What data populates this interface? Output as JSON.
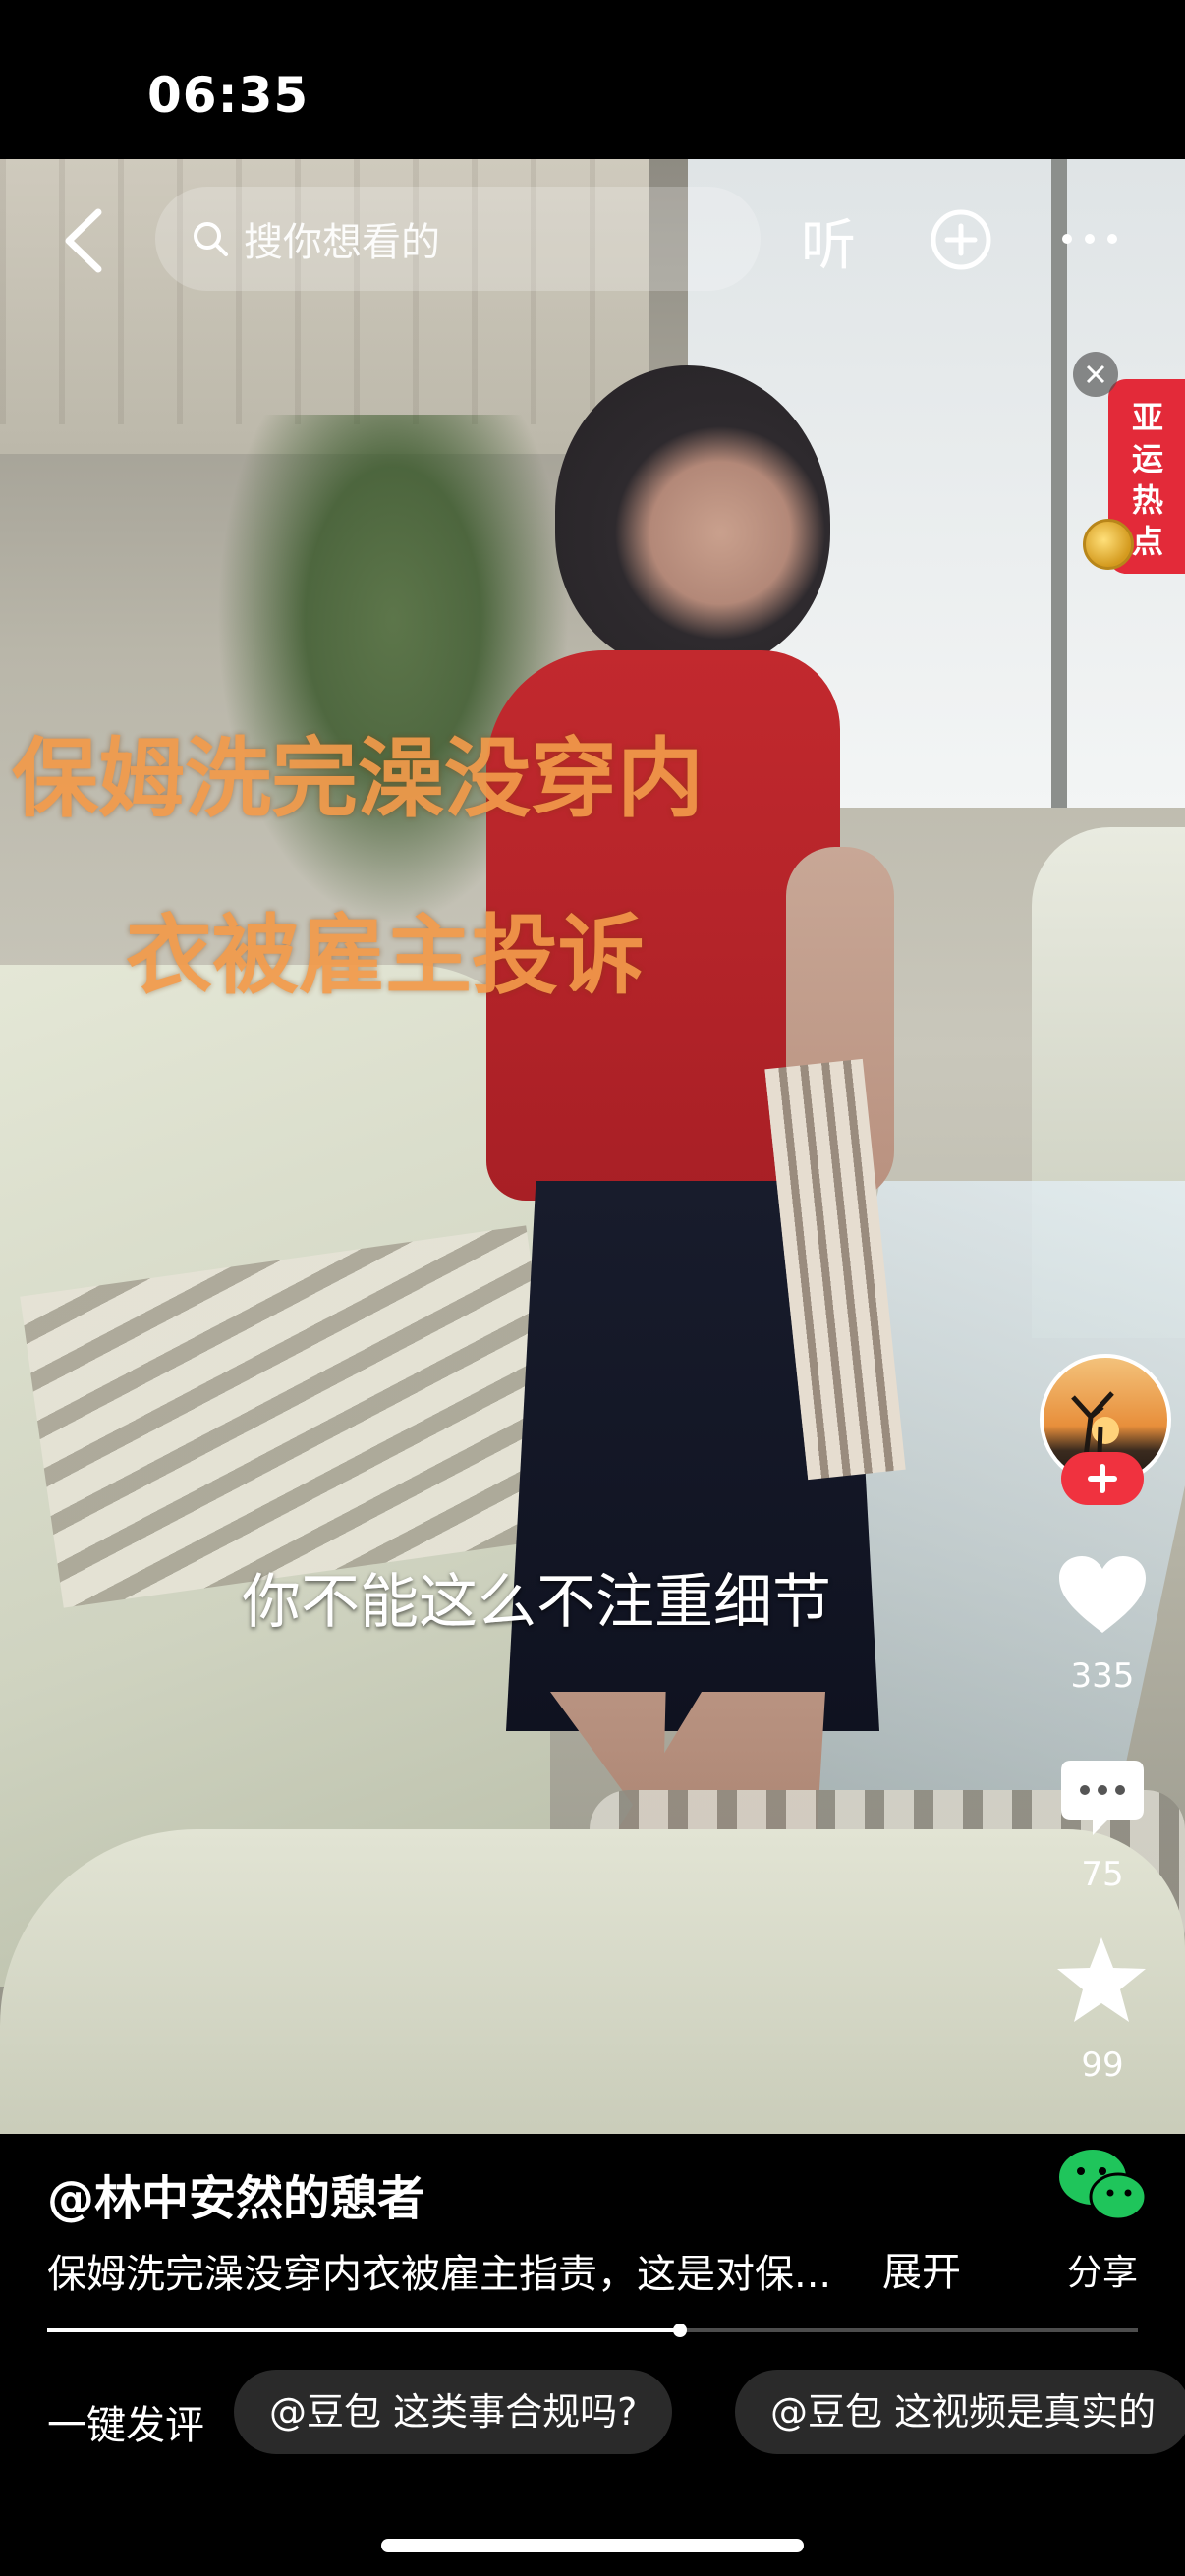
{
  "status_bar": {
    "time": "06:35"
  },
  "top_bar": {
    "search_placeholder": "搜你想看的",
    "listen_label": "听",
    "icons": {
      "back": "chevron-left-icon",
      "search": "search-icon",
      "add": "plus-circle-icon",
      "more": "more-dots-icon"
    }
  },
  "hot_badge": {
    "label": "亚运热点"
  },
  "video": {
    "overlay_line1": "保姆洗完澡没穿内",
    "overlay_line2": "衣被雇主投诉",
    "subtitle": "你不能这么不注重细节",
    "overlay_color": "#f29a4a"
  },
  "actions": {
    "like_count": "335",
    "comment_count": "75",
    "favorite_count": "99",
    "follow_color": "#f0323f"
  },
  "info": {
    "author": "@林中安然的憩者",
    "description": "保姆洗完澡没穿内衣被雇主指责，这是对保...",
    "expand_label": "展开",
    "share_label": "分享",
    "progress": 0.58
  },
  "quick_comment": {
    "label": "一键发评",
    "chips": [
      "@豆包 这类事合规吗?",
      "@豆包 这视频是真实的"
    ]
  }
}
